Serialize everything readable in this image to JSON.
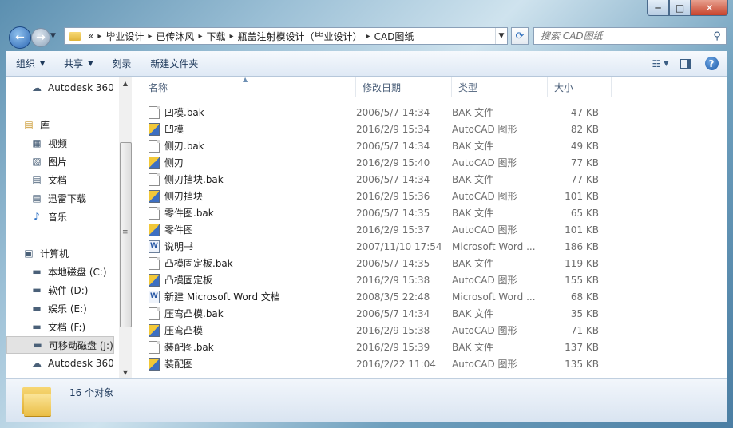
{
  "window": {
    "caption_min": "─",
    "caption_max": "□",
    "caption_close": "✕"
  },
  "address": {
    "overflow": "«",
    "crumbs": [
      "毕业设计",
      "已传沐风",
      "下载",
      "瓶盖注射模设计（毕业设计）",
      "CAD图纸"
    ]
  },
  "search": {
    "placeholder": "搜索 CAD图纸"
  },
  "toolbar": {
    "organize": "组织",
    "share": "共享",
    "burn": "刻录",
    "new_folder": "新建文件夹"
  },
  "nav_pane": [
    {
      "label": "Autodesk 360",
      "icon": "cloud-icon",
      "glyph": "☁",
      "indent": 1
    },
    {
      "label": "库",
      "icon": "library-icon",
      "glyph": "▤",
      "indent": 0
    },
    {
      "label": "视频",
      "icon": "video-icon",
      "glyph": "▦",
      "indent": 1
    },
    {
      "label": "图片",
      "icon": "picture-icon",
      "glyph": "▨",
      "indent": 1
    },
    {
      "label": "文档",
      "icon": "document-icon",
      "glyph": "▤",
      "indent": 1
    },
    {
      "label": "迅雷下载",
      "icon": "download-icon",
      "glyph": "▤",
      "indent": 1
    },
    {
      "label": "音乐",
      "icon": "music-icon",
      "glyph": "♪",
      "indent": 1
    },
    {
      "label": "计算机",
      "icon": "computer-icon",
      "glyph": "▣",
      "indent": 0
    },
    {
      "label": "本地磁盘 (C:)",
      "icon": "system-drive-icon",
      "glyph": "▬",
      "indent": 1
    },
    {
      "label": "软件 (D:)",
      "icon": "drive-icon",
      "glyph": "▬",
      "indent": 1
    },
    {
      "label": "娱乐 (E:)",
      "icon": "drive-icon",
      "glyph": "▬",
      "indent": 1
    },
    {
      "label": "文档 (F:)",
      "icon": "drive-icon",
      "glyph": "▬",
      "indent": 1
    },
    {
      "label": "可移动磁盘 (J:)",
      "icon": "removable-drive-icon",
      "glyph": "▬",
      "indent": 1,
      "selected": true
    },
    {
      "label": "Autodesk 360",
      "icon": "cloud-icon",
      "glyph": "☁",
      "indent": 1
    }
  ],
  "columns": {
    "name": "名称",
    "date": "修改日期",
    "type": "类型",
    "size": "大小"
  },
  "files": [
    {
      "name": "凹模.bak",
      "date": "2006/5/7 14:34",
      "type": "BAK 文件",
      "size": "47 KB",
      "kind": "bak"
    },
    {
      "name": "凹模",
      "date": "2016/2/9 15:34",
      "type": "AutoCAD 图形",
      "size": "82 KB",
      "kind": "dwg"
    },
    {
      "name": "侧刃.bak",
      "date": "2006/5/7 14:34",
      "type": "BAK 文件",
      "size": "49 KB",
      "kind": "bak"
    },
    {
      "name": "侧刃",
      "date": "2016/2/9 15:40",
      "type": "AutoCAD 图形",
      "size": "77 KB",
      "kind": "dwg"
    },
    {
      "name": "侧刃挡块.bak",
      "date": "2006/5/7 14:34",
      "type": "BAK 文件",
      "size": "77 KB",
      "kind": "bak"
    },
    {
      "name": "侧刃挡块",
      "date": "2016/2/9 15:36",
      "type": "AutoCAD 图形",
      "size": "101 KB",
      "kind": "dwg"
    },
    {
      "name": "零件图.bak",
      "date": "2006/5/7 14:35",
      "type": "BAK 文件",
      "size": "65 KB",
      "kind": "bak"
    },
    {
      "name": "零件图",
      "date": "2016/2/9 15:37",
      "type": "AutoCAD 图形",
      "size": "101 KB",
      "kind": "dwg"
    },
    {
      "name": "说明书",
      "date": "2007/11/10 17:54",
      "type": "Microsoft Word ...",
      "size": "186 KB",
      "kind": "doc"
    },
    {
      "name": "凸模固定板.bak",
      "date": "2006/5/7 14:35",
      "type": "BAK 文件",
      "size": "119 KB",
      "kind": "bak"
    },
    {
      "name": "凸模固定板",
      "date": "2016/2/9 15:38",
      "type": "AutoCAD 图形",
      "size": "155 KB",
      "kind": "dwg"
    },
    {
      "name": "新建 Microsoft Word 文档",
      "date": "2008/3/5 22:48",
      "type": "Microsoft Word ...",
      "size": "68 KB",
      "kind": "doc"
    },
    {
      "name": "压弯凸模.bak",
      "date": "2006/5/7 14:34",
      "type": "BAK 文件",
      "size": "35 KB",
      "kind": "bak"
    },
    {
      "name": "压弯凸模",
      "date": "2016/2/9 15:38",
      "type": "AutoCAD 图形",
      "size": "71 KB",
      "kind": "dwg"
    },
    {
      "name": "装配图.bak",
      "date": "2016/2/9 15:39",
      "type": "BAK 文件",
      "size": "137 KB",
      "kind": "bak"
    },
    {
      "name": "装配图",
      "date": "2016/2/22 11:04",
      "type": "AutoCAD 图形",
      "size": "135 KB",
      "kind": "dwg"
    }
  ],
  "status": {
    "count": "16 个对象"
  }
}
